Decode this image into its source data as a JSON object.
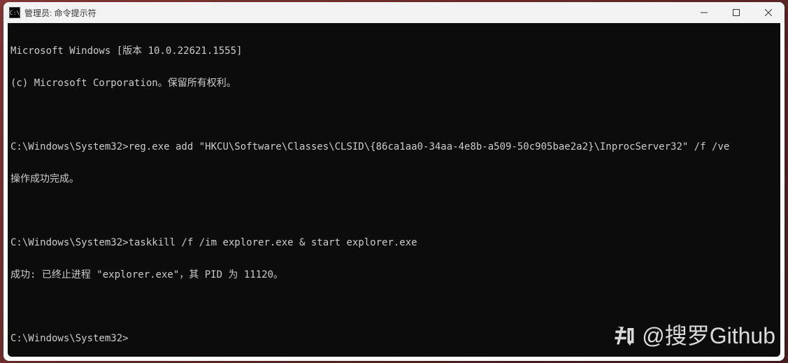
{
  "window": {
    "title": "管理员: 命令提示符",
    "icon_label": "C:\\"
  },
  "terminal": {
    "line1": "Microsoft Windows [版本 10.0.22621.1555]",
    "line2": "(c) Microsoft Corporation。保留所有权利。",
    "prompt1": "C:\\Windows\\System32>",
    "cmd1": "reg.exe add \"HKCU\\Software\\Classes\\CLSID\\{86ca1aa0-34aa-4e8b-a509-50c905bae2a2}\\InprocServer32\" /f /ve",
    "result1": "操作成功完成。",
    "prompt2": "C:\\Windows\\System32>",
    "cmd2": "taskkill /f /im explorer.exe & start explorer.exe",
    "result2": "成功: 已终止进程 \"explorer.exe\"，其 PID 为 11120。",
    "prompt3": "C:\\Windows\\System32>",
    "cmd3": ""
  },
  "watermark": {
    "text": "@搜罗Github",
    "brand": "知乎"
  }
}
